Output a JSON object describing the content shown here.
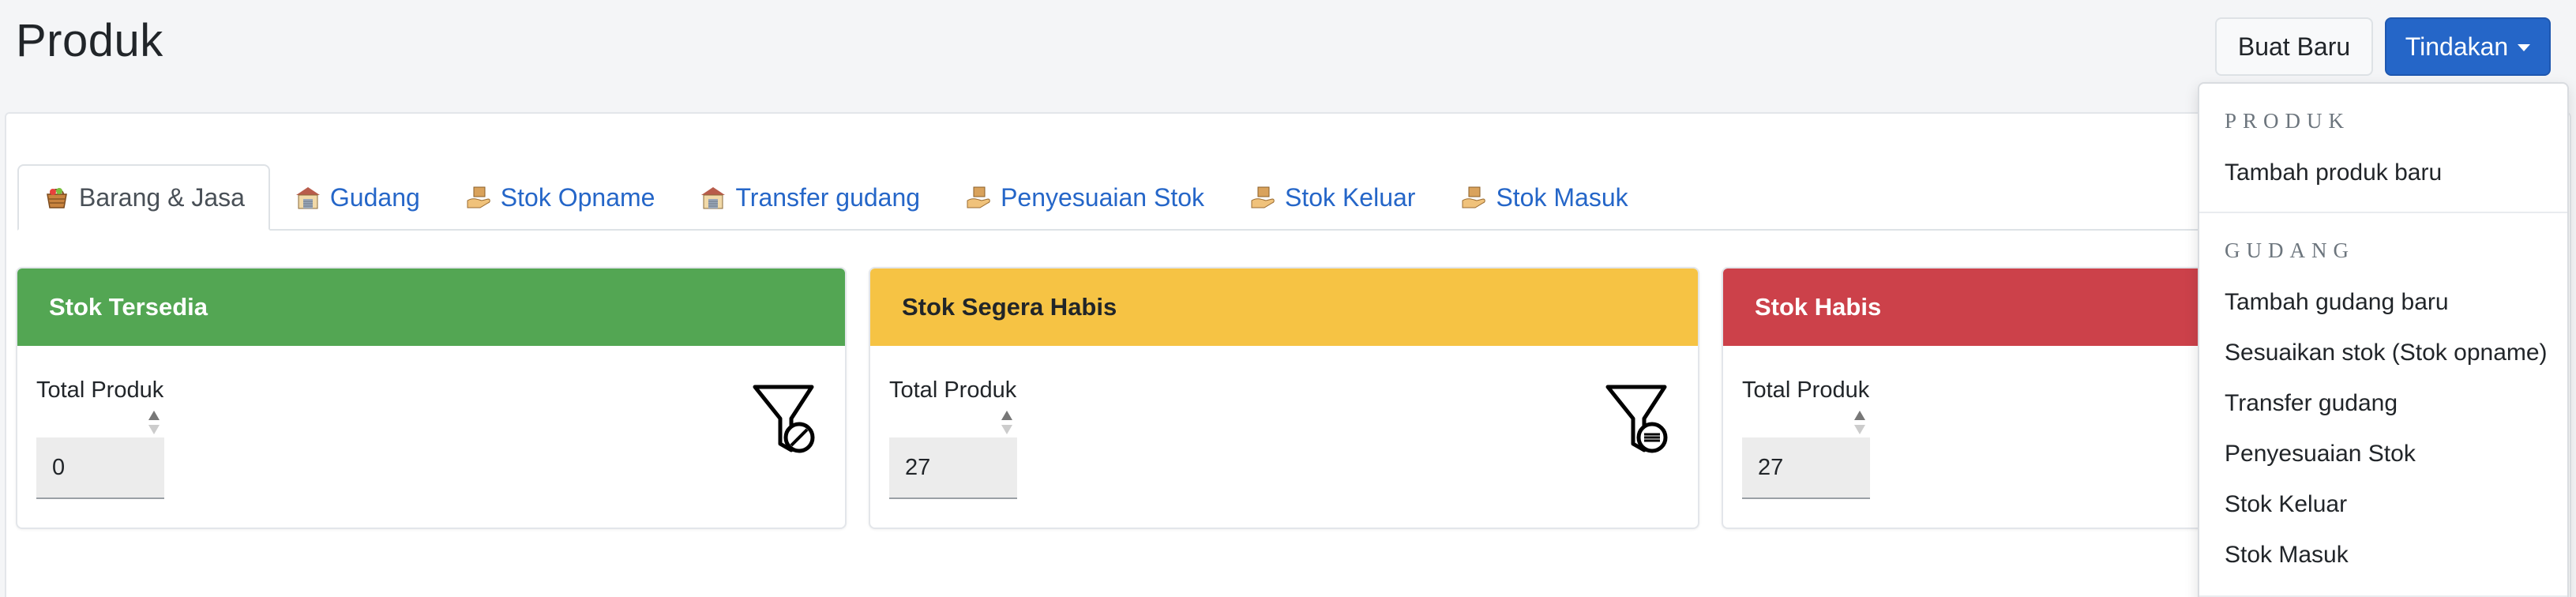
{
  "page": {
    "title": "Produk"
  },
  "header": {
    "new_button": "Buat Baru",
    "actions_button": "Tindakan"
  },
  "tabs": [
    {
      "label": "Barang & Jasa",
      "icon": "basket-icon",
      "active": true
    },
    {
      "label": "Gudang",
      "icon": "warehouse-icon",
      "active": false
    },
    {
      "label": "Stok Opname",
      "icon": "hand-box-icon",
      "active": false
    },
    {
      "label": "Transfer gudang",
      "icon": "warehouse-icon",
      "active": false
    },
    {
      "label": "Penyesuaian Stok",
      "icon": "hand-box-icon",
      "active": false
    },
    {
      "label": "Stok Keluar",
      "icon": "hand-box-icon",
      "active": false
    },
    {
      "label": "Stok Masuk",
      "icon": "hand-box-icon",
      "active": false
    }
  ],
  "stats": [
    {
      "title": "Stok Tersedia",
      "label": "Total Produk",
      "value": "0",
      "color": "#53a653",
      "title_color": "#ffffff"
    },
    {
      "title": "Stok Segera Habis",
      "label": "Total Produk",
      "value": "27",
      "color": "#f6c344",
      "title_color": "#212529"
    },
    {
      "title": "Stok Habis",
      "label": "Total Produk",
      "value": "27",
      "color": "#cc414a",
      "title_color": "#ffffff"
    }
  ],
  "dropdown": {
    "sections": [
      {
        "header": "PRODUK",
        "items": [
          "Tambah produk baru"
        ]
      },
      {
        "header": "GUDANG",
        "items": [
          "Tambah gudang baru",
          "Sesuaikan stok (Stok opname)",
          "Transfer gudang",
          "Penyesuaian Stok",
          "Stok Keluar",
          "Stok Masuk"
        ]
      }
    ]
  },
  "colors": {
    "primary": "#2566c8",
    "link": "#2566c8"
  }
}
